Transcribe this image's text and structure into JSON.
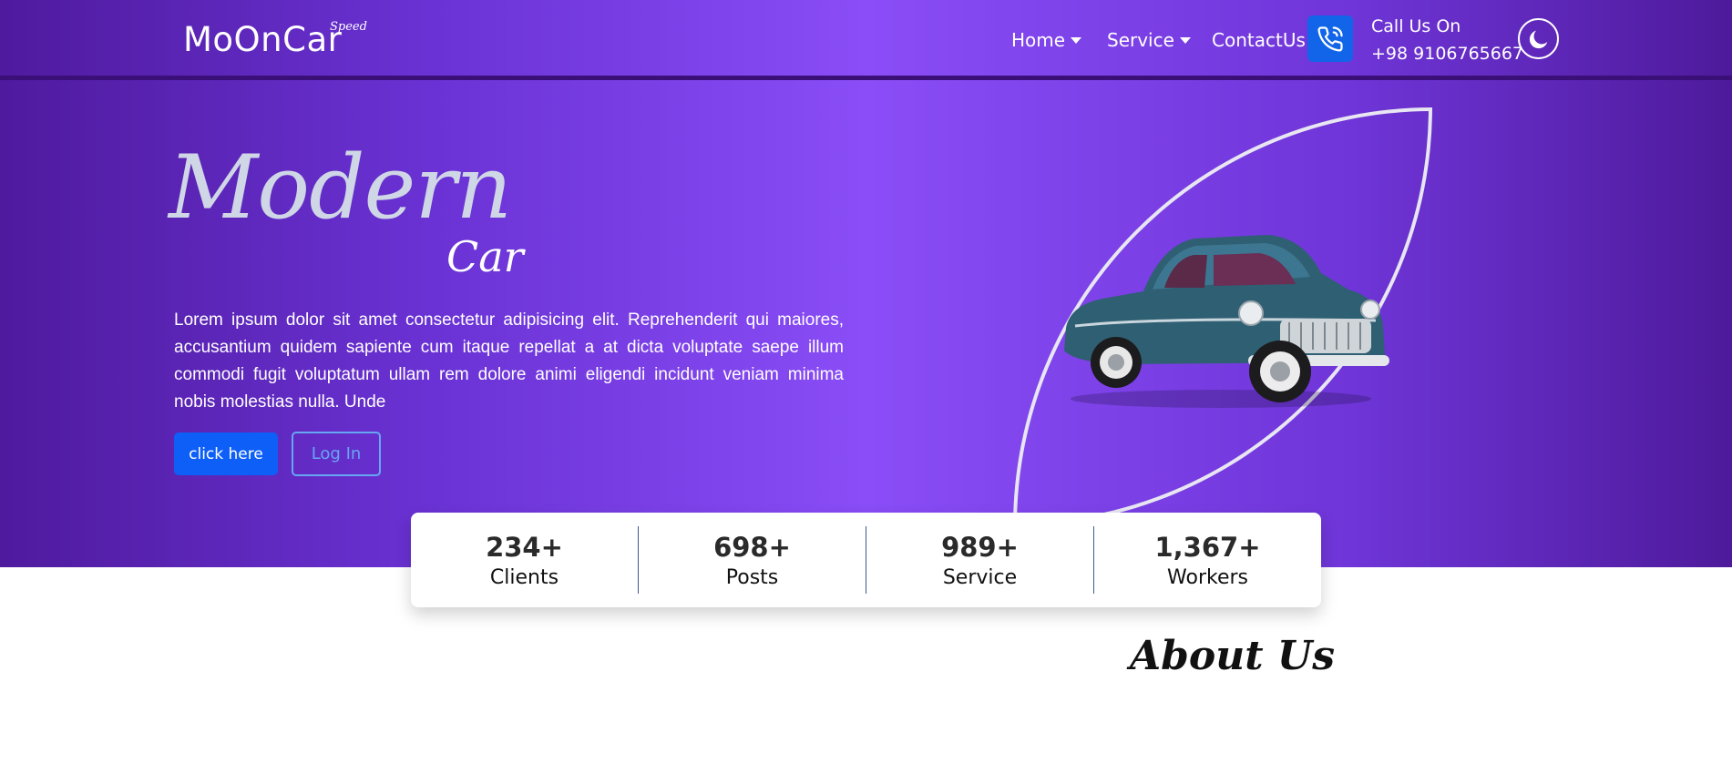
{
  "nav": {
    "brand": "MoOnCar",
    "brand_sup": "Speed",
    "links": [
      {
        "label": "Home",
        "dropdown": true
      },
      {
        "label": "Service",
        "dropdown": true
      },
      {
        "label": "ContactUs",
        "dropdown": false
      }
    ],
    "call_label": "Call Us On",
    "call_number": "+98 9106765667",
    "phone_icon": "phone-icon",
    "theme_icon": "moon-icon"
  },
  "hero": {
    "title_main": "Modern",
    "title_sub": "Car",
    "description": "Lorem ipsum dolor sit amet consectetur adipisicing elit. Reprehenderit qui maiores, accusantium quidem sapiente cum itaque repellat a at dicta voluptate saepe illum commodi fugit voluptatum ullam rem dolore animi eligendi incidunt veniam minima nobis molestias nulla. Unde",
    "primary_button": "click here",
    "secondary_button": "Log In",
    "image": "vintage-car-image"
  },
  "stats": [
    {
      "value": "234+",
      "label": "Clients"
    },
    {
      "value": "698+",
      "label": "Posts"
    },
    {
      "value": "989+",
      "label": "Service"
    },
    {
      "value": "1,367+",
      "label": "Workers"
    }
  ],
  "about": {
    "title": "About Us"
  },
  "colors": {
    "accent": "#0d5ff8",
    "hero_mid": "#8a4df7",
    "hero_edge": "#4f1a9e"
  }
}
